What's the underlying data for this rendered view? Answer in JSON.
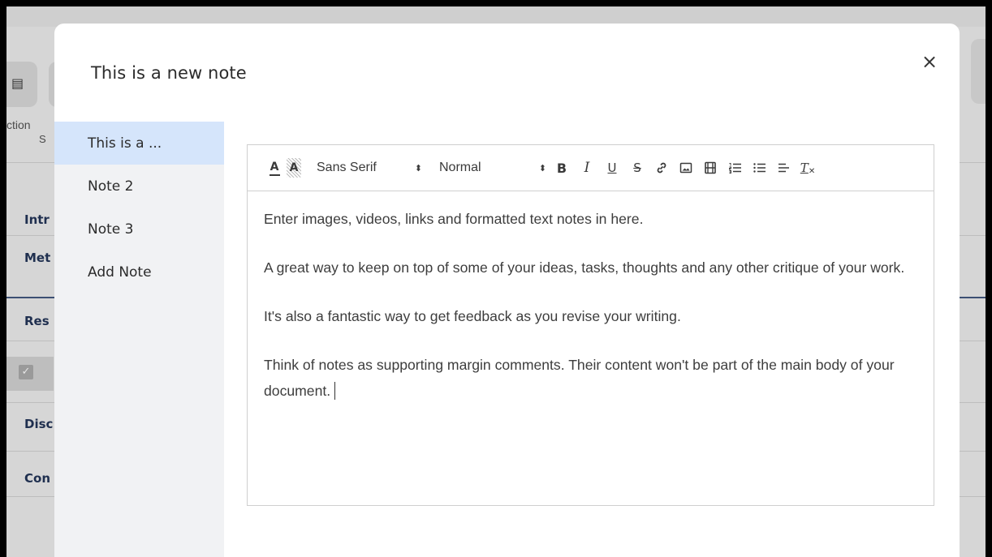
{
  "background": {
    "tool_label": "ction",
    "tool_label2": "S",
    "sections": [
      "Intr",
      "Met",
      "Res",
      "Disc",
      "Con"
    ]
  },
  "modal": {
    "title": "This is a new note",
    "close_label": "×"
  },
  "sidebar": {
    "items": [
      {
        "label": "This is a ..."
      },
      {
        "label": "Note 2"
      },
      {
        "label": "Note 3"
      },
      {
        "label": "Add Note"
      }
    ]
  },
  "toolbar": {
    "text_color_label": "A",
    "background_label": "A",
    "font": {
      "value": "Sans Serif",
      "arrow": "⬍"
    },
    "size": {
      "value": "Normal",
      "arrow": "⬍"
    },
    "bold_label": "B",
    "italic_label": "I",
    "underline_label": "U",
    "strike_label": "S",
    "clean_label": "T"
  },
  "editor": {
    "paragraphs": [
      "Enter images, videos, links and formatted text notes in here.",
      "A great way to keep on top of some of your ideas, tasks, thoughts and any other critique of your work.",
      "It's also a fantastic way to get feedback as you revise your writing.",
      "Think of notes as supporting margin comments. Their content won't be part of the main body of your document."
    ]
  },
  "colors": {
    "sidebar_active": "#d5e5fb",
    "sidebar_bg": "#f1f2f4",
    "section_text": "#1f2f4f"
  }
}
